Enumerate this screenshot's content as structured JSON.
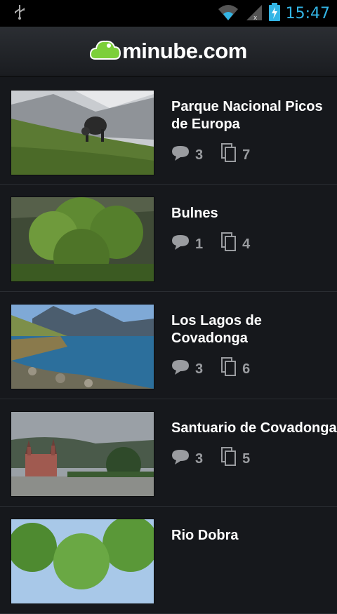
{
  "status_bar": {
    "time": "15:47"
  },
  "header": {
    "brand": "minube.com"
  },
  "items": [
    {
      "title": "Parque Nacional Picos de Europa",
      "comments": "3",
      "photos": "7"
    },
    {
      "title": "Bulnes",
      "comments": "1",
      "photos": "4"
    },
    {
      "title": "Los Lagos de Covadonga",
      "comments": "3",
      "photos": "6"
    },
    {
      "title": "Santuario de Covadonga",
      "comments": "3",
      "photos": "5"
    },
    {
      "title": "Rio Dobra",
      "comments": "",
      "photos": ""
    }
  ],
  "colors": {
    "accent": "#33b5e5",
    "brand_green": "#7ccf3a",
    "background": "#16181c",
    "stat_gray": "#9a9ca0"
  },
  "icons": {
    "comment": "speech-bubble-icon",
    "photos": "stacked-photos-icon"
  }
}
